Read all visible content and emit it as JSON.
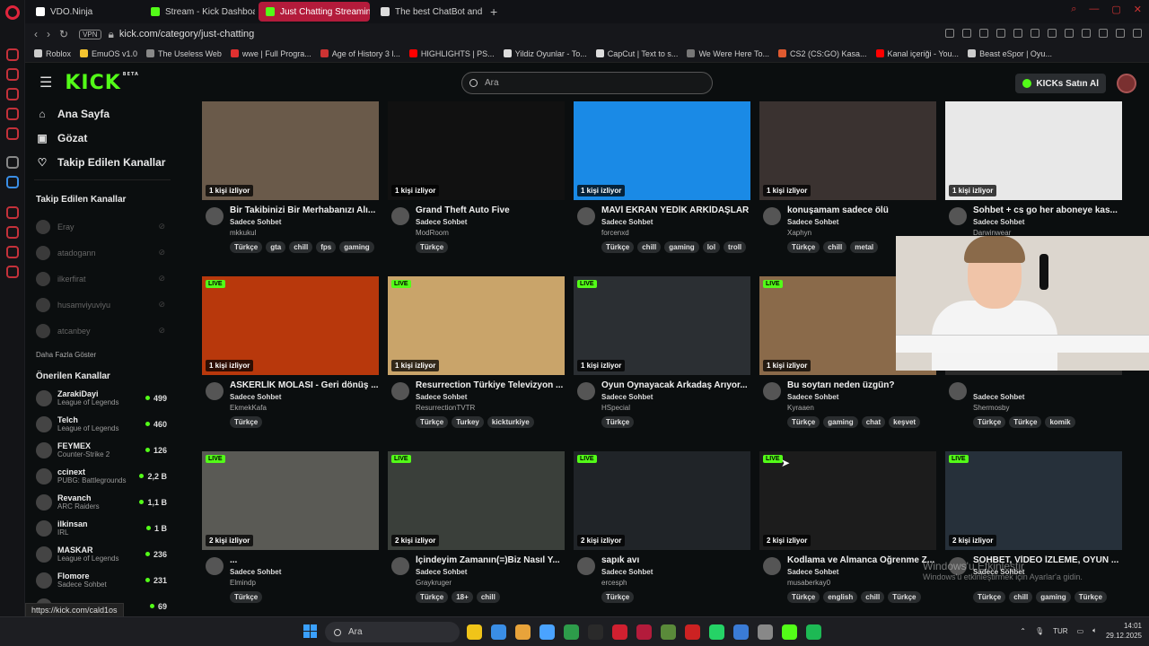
{
  "browser": {
    "tabs": [
      {
        "label": "VDO.Ninja",
        "color": "#ffffff"
      },
      {
        "label": "Stream - Kick Dashboard",
        "color": "#53fc18"
      },
      {
        "label": "Just Chatting Streaming -",
        "color": "#53fc18"
      },
      {
        "label": "The best ChatBot and Wid",
        "color": "#dddddd"
      }
    ],
    "new_tab": "+",
    "vpn": "VPN",
    "url": "kick.com/category/just-chatting",
    "bookmarks": [
      {
        "label": "Roblox",
        "color": "#cccccc"
      },
      {
        "label": "EmuOS v1.0",
        "color": "#f4c430"
      },
      {
        "label": "The Useless Web",
        "color": "#888888"
      },
      {
        "label": "wwe | Full Progra...",
        "color": "#e03030"
      },
      {
        "label": "Age of History 3 l...",
        "color": "#cc3333"
      },
      {
        "label": "HIGHLIGHTS | PS...",
        "color": "#ff0000"
      },
      {
        "label": "Yildiz Oyunlar - To...",
        "color": "#dddddd"
      },
      {
        "label": "CapCut | Text to s...",
        "color": "#dddddd"
      },
      {
        "label": "We Were Here To...",
        "color": "#777777"
      },
      {
        "label": "CS2 (CS:GO) Kasa...",
        "color": "#e05a30"
      },
      {
        "label": "Kanal içeriği - You...",
        "color": "#ff0000"
      },
      {
        "label": "Beast eSpor | Oyu...",
        "color": "#cccccc"
      }
    ],
    "status_url": "https://kick.com/cald1os"
  },
  "kick": {
    "logo": "KICK",
    "beta": "BETA",
    "search_placeholder": "Ara",
    "kicks_button": "KICKs Satın Al",
    "nav": [
      {
        "label": "Ana Sayfa",
        "icon": "⌂"
      },
      {
        "label": "Gözat",
        "icon": "▣"
      },
      {
        "label": "Takip Edilen Kanallar",
        "icon": "♡"
      }
    ],
    "following_title": "Takip Edilen Kanallar",
    "following": [
      "Eray",
      "atadogann",
      "ilkerfirat",
      "husamviyuviyu",
      "atcanbey"
    ],
    "show_more": "Daha Fazla Göster",
    "recommended_title": "Önerilen Kanallar",
    "recommended": [
      {
        "name": "ZarakiDayi",
        "category": "League of Legends",
        "viewers": "499"
      },
      {
        "name": "Telch",
        "category": "League of Legends",
        "viewers": "460"
      },
      {
        "name": "FEYMEX",
        "category": "Counter-Strike 2",
        "viewers": "126"
      },
      {
        "name": "ccinext",
        "category": "PUBG: Battlegrounds",
        "viewers": "2,2 B"
      },
      {
        "name": "Revanch",
        "category": "ARC Raiders",
        "viewers": "1,1 B"
      },
      {
        "name": "ilkinsan",
        "category": "IRL",
        "viewers": "1 B"
      },
      {
        "name": "MASKAR",
        "category": "League of Legends",
        "viewers": "236"
      },
      {
        "name": "Flomore",
        "category": "Sadece Sohbet",
        "viewers": "231"
      },
      {
        "name": "",
        "category": "",
        "viewers": "69"
      }
    ],
    "live_badge": "LIVE",
    "streams": [
      {
        "title": "Bir Takibinizi Bir Merhabanızı Alı...",
        "category": "Sadece Sohbet",
        "channel": "mkkukul",
        "viewers": "1 kişi izliyor",
        "tags": [
          "Türkçe",
          "gta",
          "chill",
          "fps",
          "gaming"
        ],
        "live": false,
        "thumb": "#6a5a4a"
      },
      {
        "title": "Grand Theft Auto Five",
        "category": "Sadece Sohbet",
        "channel": "ModRoom",
        "viewers": "1 kişi izliyor",
        "tags": [
          "Türkçe"
        ],
        "live": false,
        "thumb": "#111111"
      },
      {
        "title": "MAVİ EKRAN YEDİK ARKİDAŞLAR",
        "category": "Sadece Sohbet",
        "channel": "forcenxd",
        "viewers": "1 kişi izliyor",
        "tags": [
          "Türkçe",
          "chill",
          "gaming",
          "lol",
          "troll"
        ],
        "live": false,
        "thumb": "#1a8ae6"
      },
      {
        "title": "konuşamam sadece ölü",
        "category": "Sadece Sohbet",
        "channel": "Xaphyn",
        "viewers": "1 kişi izliyor",
        "tags": [
          "Türkçe",
          "chill",
          "metal"
        ],
        "live": false,
        "thumb": "#3a3230"
      },
      {
        "title": "Sohbet + cs go her aboneye kas...",
        "category": "Sadece Sohbet",
        "channel": "Darwinwear",
        "viewers": "1 kişi izliyor",
        "tags": [
          "Türkçe",
          "18+",
          "chill",
          "gaming"
        ],
        "live": false,
        "thumb": "#e8e8e8"
      },
      {
        "title": "ASKERLİK MOLASI - Geri dönüş ...",
        "category": "Sadece Sohbet",
        "channel": "EkmekKafa",
        "viewers": "1 kişi izliyor",
        "tags": [
          "Türkçe"
        ],
        "live": true,
        "thumb": "#b8380c"
      },
      {
        "title": "Resurrection Türkiye Televizyon ...",
        "category": "Sadece Sohbet",
        "channel": "ResurrectionTVTR",
        "viewers": "1 kişi izliyor",
        "tags": [
          "Türkçe",
          "Turkey",
          "kickturkiye"
        ],
        "live": true,
        "thumb": "#c9a46a"
      },
      {
        "title": "Oyun Oynayacak Arkadaş Arıyor...",
        "category": "Sadece Sohbet",
        "channel": "HSpecial",
        "viewers": "1 kişi izliyor",
        "tags": [
          "Türkçe"
        ],
        "live": true,
        "thumb": "#2b2f33"
      },
      {
        "title": "Bu soytarı neden üzgün?",
        "category": "Sadece Sohbet",
        "channel": "Kyraaen",
        "viewers": "1 kişi izliyor",
        "tags": [
          "Türkçe",
          "gaming",
          "chat",
          "keşvet"
        ],
        "live": true,
        "thumb": "#8a6a4a"
      },
      {
        "title": "",
        "category": "Sadece Sohbet",
        "channel": "Shermosby",
        "viewers": "",
        "tags": [
          "Türkçe",
          "Türkçe",
          "komik"
        ],
        "live": false,
        "thumb": "#2a2a2a"
      },
      {
        "title": "...",
        "category": "Sadece Sohbet",
        "channel": "Elmindp",
        "viewers": "2 kişi izliyor",
        "tags": [
          "Türkçe"
        ],
        "live": true,
        "thumb": "#5a5a55"
      },
      {
        "title": "İçindeyim Zamanın(=)Biz Nasıl Y...",
        "category": "Sadece Sohbet",
        "channel": "Graykruger",
        "viewers": "2 kişi izliyor",
        "tags": [
          "Türkçe",
          "18+",
          "chill"
        ],
        "live": true,
        "thumb": "#3a3f3a"
      },
      {
        "title": "sapık avı",
        "category": "Sadece Sohbet",
        "channel": "ercesph",
        "viewers": "2 kişi izliyor",
        "tags": [
          "Türkçe"
        ],
        "live": true,
        "thumb": "#202428"
      },
      {
        "title": "Kodlama ve Almanca Öğrenme Z...",
        "category": "Sadece Sohbet",
        "channel": "musaberkay0",
        "viewers": "2 kişi izliyor",
        "tags": [
          "Türkçe",
          "english",
          "chill",
          "Türkçe"
        ],
        "live": true,
        "thumb": "#1c1c1c"
      },
      {
        "title": "SOHBET, VİDEO İZLEME, OYUN ...",
        "category": "Sadece Sohbet",
        "channel": "",
        "viewers": "2 kişi izliyor",
        "tags": [
          "Türkçe",
          "chill",
          "gaming",
          "Türkçe"
        ],
        "live": true,
        "thumb": "#26303a"
      }
    ]
  },
  "watermark": {
    "line1": "Windows'u Etkinleştir",
    "line2": "Windows'u etkinleştirmek için Ayarlar'a gidin."
  },
  "taskbar": {
    "search": "Ara",
    "lang": "TUR",
    "time": "14:01",
    "date": "29.12.2025",
    "apps": [
      "#f0c419",
      "#3a8ee6",
      "#e8a33a",
      "#4aa3ff",
      "#2d9c4a",
      "#2a2a2a",
      "#d02030",
      "#b31b3b",
      "#5a8a3a",
      "#cc2222",
      "#25d366",
      "#3a7bd5",
      "#888888",
      "#53fc18",
      "#1db954"
    ]
  }
}
